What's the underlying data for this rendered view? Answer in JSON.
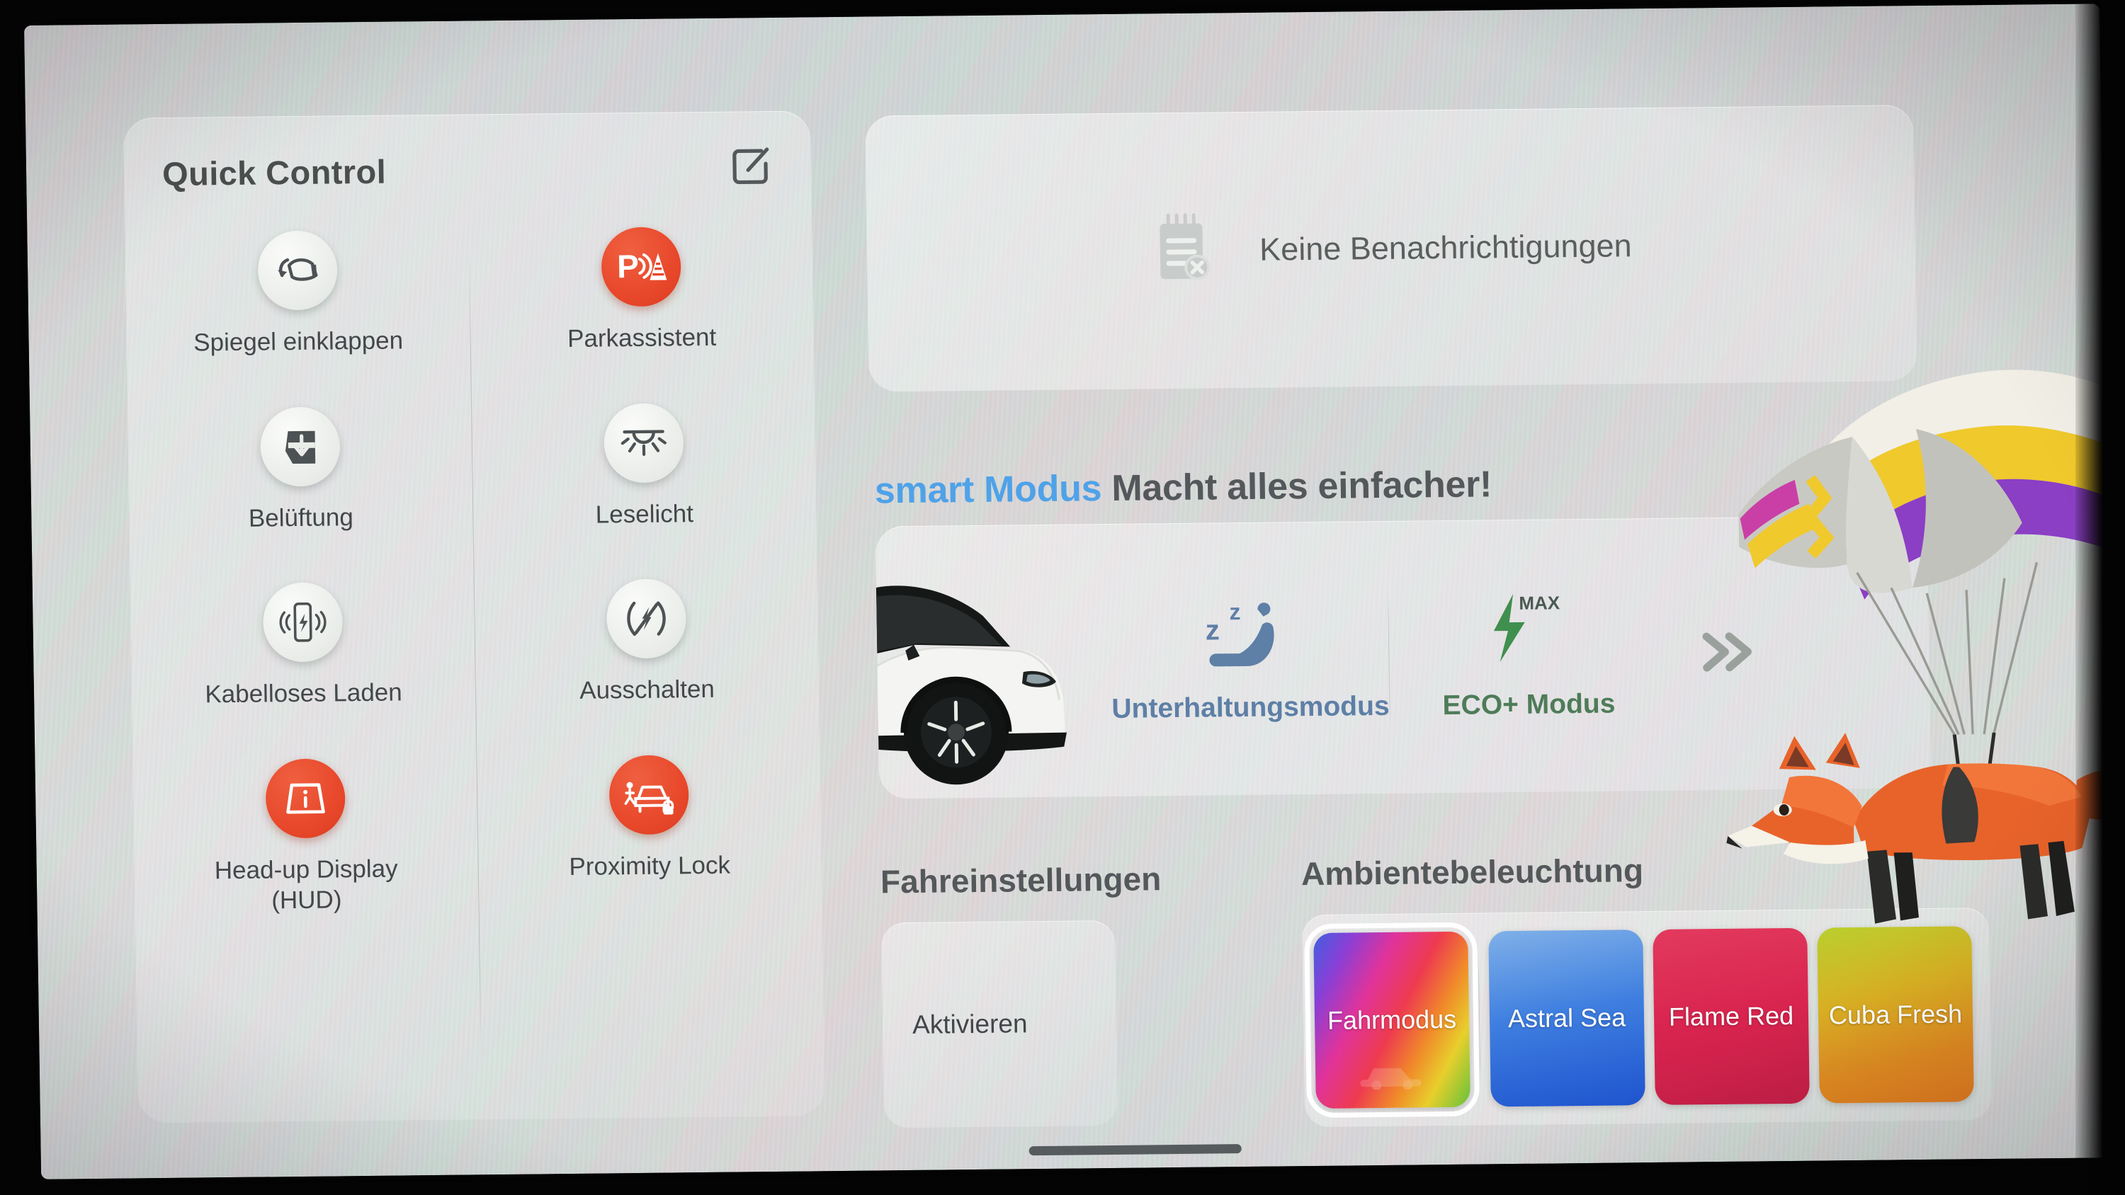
{
  "quick_control": {
    "title": "Quick Control",
    "edit_icon": "edit-icon",
    "tiles": [
      {
        "label": "Spiegel einklappen",
        "icon": "mirror-fold-icon",
        "style": "light"
      },
      {
        "label": "Parkassistent",
        "icon": "park-assist-icon",
        "style": "red"
      },
      {
        "label": "Belüftung",
        "icon": "ventilation-icon",
        "style": "light"
      },
      {
        "label": "Leselicht",
        "icon": "reading-light-icon",
        "style": "light"
      },
      {
        "label": "Kabelloses Laden",
        "icon": "wireless-charge-icon",
        "style": "light"
      },
      {
        "label": "Ausschalten",
        "icon": "power-off-icon",
        "style": "light"
      },
      {
        "label": "Head-up Display\n(HUD)",
        "icon": "hud-icon",
        "style": "red"
      },
      {
        "label": "Proximity Lock",
        "icon": "proximity-lock-icon",
        "style": "red"
      }
    ]
  },
  "notifications": {
    "empty_text": "Keine Benachrichtigungen",
    "icon": "no-notes-icon"
  },
  "smart_mode": {
    "brand": "smart Modus",
    "tagline": " Macht alles einfacher!",
    "brand_color": "#4fa2e8",
    "car_image": "smart-ev-car-image",
    "modes": [
      {
        "label": "Unterhaltungsmodus",
        "icon": "sleep-seat-icon",
        "color": "#5e7fa6"
      },
      {
        "label": "ECO+ Modus",
        "icon": "eco-max-bolt-icon",
        "color": "#4e7c58",
        "badge": "MAX"
      }
    ],
    "more_icon": "double-chevron-right-icon"
  },
  "drive_settings": {
    "heading": "Fahreinstellungen",
    "activate_label": "Aktivieren"
  },
  "ambient_lighting": {
    "heading": "Ambientebeleuchtung",
    "swatches": [
      {
        "label": "Fahrmodus",
        "selected": true,
        "gradient": "linear-gradient(118deg,#3f5fe0 0%,#8a3fd6 16%,#e0339a 34%,#ee3b4f 52%,#f08a2a 68%,#e8cf2c 82%,#62c23a 100%)",
        "icon": "car-silhouette-icon"
      },
      {
        "label": "Astral Sea",
        "selected": false,
        "gradient": "linear-gradient(170deg,#7fb0e8 0%,#3f7fe0 46%,#1f54cf 100%)"
      },
      {
        "label": "Flame Red",
        "selected": false,
        "gradient": "linear-gradient(170deg,#e33a5e 0%,#d8244f 50%,#c41f47 100%)"
      },
      {
        "label": "Cuba Fresh",
        "selected": false,
        "gradient": "linear-gradient(165deg,#b9cf2e 0%,#d9b023 38%,#e08a22 72%,#e07a20 100%)"
      }
    ]
  },
  "decoration": {
    "artwork": "fox-with-paraglider-illustration"
  },
  "system": {
    "home_indicator": "home-indicator-bar"
  },
  "colors": {
    "accent_red": "#e8472a",
    "brand_blue": "#4fa2e8",
    "eco_green": "#4e7c58",
    "text_dark": "#43474a"
  }
}
